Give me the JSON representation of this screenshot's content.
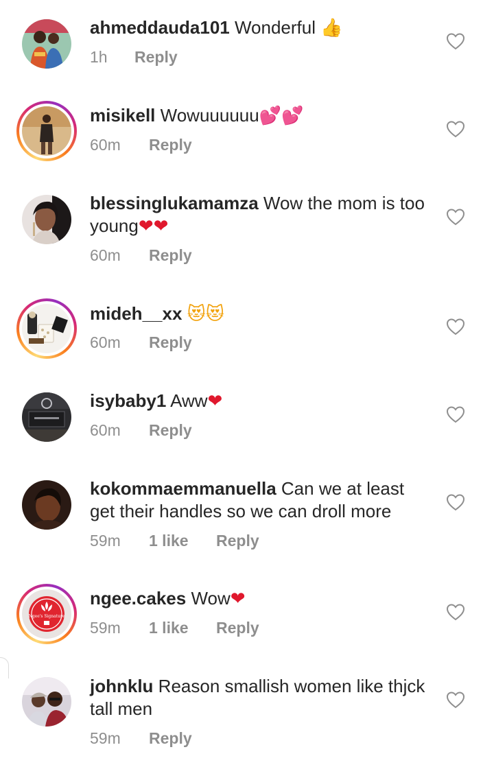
{
  "comments": [
    {
      "username": "ahmeddauda101",
      "text": "Wonderful",
      "emoji": "👍",
      "emoji_kind": "thumb",
      "time": "1h",
      "likes": "",
      "reply": "Reply"
    },
    {
      "username": "misikell",
      "text": "Wowuuuuuu",
      "emoji": "💕💕",
      "emoji_kind": "hearts",
      "time": "60m",
      "likes": "",
      "reply": "Reply"
    },
    {
      "username": "blessinglukamamza",
      "text": "Wow the mom is too young",
      "emoji": "❤❤",
      "emoji_kind": "heart",
      "time": "60m",
      "likes": "",
      "reply": "Reply"
    },
    {
      "username": "mideh__xx",
      "text": "",
      "emoji": "😻😻",
      "emoji_kind": "cat",
      "time": "60m",
      "likes": "",
      "reply": "Reply"
    },
    {
      "username": "isybaby1",
      "text": "Aww",
      "emoji": "❤",
      "emoji_kind": "heart",
      "time": "60m",
      "likes": "",
      "reply": "Reply"
    },
    {
      "username": "kokommaemmanuella",
      "text": "Can we at least get their handles so we can droll more",
      "emoji": "",
      "emoji_kind": "",
      "time": "59m",
      "likes": "1 like",
      "reply": "Reply"
    },
    {
      "username": "ngee.cakes",
      "text": "Wow",
      "emoji": "❤",
      "emoji_kind": "heart",
      "time": "59m",
      "likes": "1 like",
      "reply": "Reply"
    },
    {
      "username": "johnklu",
      "text": "Reason smallish women like thjck tall men",
      "emoji": "",
      "emoji_kind": "",
      "time": "59m",
      "likes": "",
      "reply": "Reply"
    }
  ],
  "avatar_seal_text": "Ngee's Signature",
  "colors": {
    "text": "#262626",
    "meta": "#8e8e8e",
    "heart_icon_stroke": "#8e8e8e"
  }
}
